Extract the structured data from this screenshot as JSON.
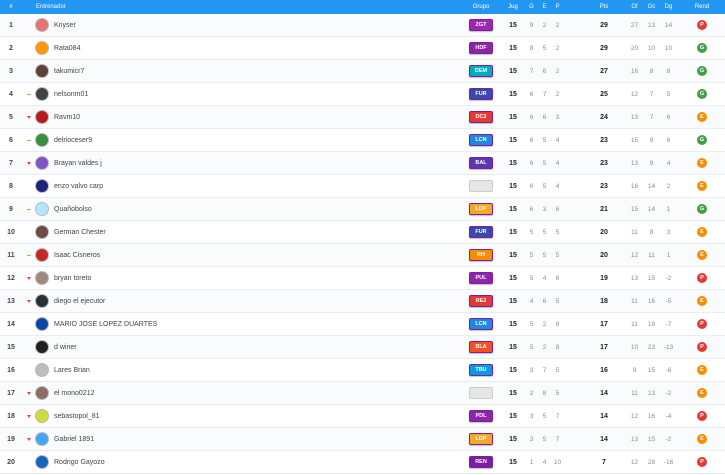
{
  "header": {
    "pos": "#",
    "team": "Entrenador",
    "group": "Grupo",
    "jug": "Jug",
    "g": "G",
    "e": "E",
    "p": "P",
    "pts": "Pts",
    "gf": "Gf",
    "gc": "Gc",
    "dg": "Dg",
    "rend": "Rend"
  },
  "colors": {
    "header_bg": "#2196f3",
    "rend_P": "#e53935",
    "rend_E": "#fb8c00",
    "rend_G": "#43a047"
  },
  "rows": [
    {
      "pos": "1",
      "trend": "none",
      "name": "Knyser",
      "group": "ZGT",
      "group_color": "#9c27b0",
      "jug": "15",
      "g": "9",
      "e": "2",
      "p": "2",
      "pts": "29",
      "gf": "27",
      "gc": "13",
      "dg": "14",
      "rend": "P",
      "avatar": "#e57373"
    },
    {
      "pos": "2",
      "trend": "none",
      "name": "Rata084",
      "group": "HDF",
      "group_color": "#8e24aa",
      "jug": "15",
      "g": "8",
      "e": "5",
      "p": "2",
      "pts": "29",
      "gf": "20",
      "gc": "10",
      "dg": "10",
      "rend": "G",
      "avatar": "#ff9800"
    },
    {
      "pos": "3",
      "trend": "none",
      "name": "takumicr7",
      "group": "DEM",
      "group_color": "#00acc1",
      "jug": "15",
      "g": "7",
      "e": "6",
      "p": "2",
      "pts": "27",
      "gf": "16",
      "gc": "8",
      "dg": "8",
      "rend": "G",
      "avatar": "#5d4037"
    },
    {
      "pos": "4",
      "trend": "flat",
      "name": "nelsonm01",
      "group": "FUR",
      "group_color": "#3949ab",
      "jug": "15",
      "g": "6",
      "e": "7",
      "p": "2",
      "pts": "25",
      "gf": "12",
      "gc": "7",
      "dg": "5",
      "rend": "G",
      "avatar": "#424242"
    },
    {
      "pos": "5",
      "trend": "down",
      "name": "Ravm10",
      "group": "DC2",
      "group_color": "#e53935",
      "jug": "15",
      "g": "6",
      "e": "6",
      "p": "3",
      "pts": "24",
      "gf": "13",
      "gc": "7",
      "dg": "6",
      "rend": "E",
      "avatar": "#b71c1c"
    },
    {
      "pos": "6",
      "trend": "flat",
      "name": "delrioceser9",
      "group": "LCN",
      "group_color": "#1e88e5",
      "jug": "15",
      "g": "6",
      "e": "5",
      "p": "4",
      "pts": "23",
      "gf": "15",
      "gc": "9",
      "dg": "6",
      "rend": "G",
      "avatar": "#388e3c"
    },
    {
      "pos": "7",
      "trend": "down",
      "name": "Brayan valdes j",
      "group": "BAL",
      "group_color": "#5e35b1",
      "jug": "15",
      "g": "6",
      "e": "5",
      "p": "4",
      "pts": "23",
      "gf": "13",
      "gc": "9",
      "dg": "4",
      "rend": "E",
      "avatar": "#7e57c2"
    },
    {
      "pos": "8",
      "trend": "none",
      "name": "enzo valvo carp",
      "group": "",
      "group_color": "",
      "jug": "15",
      "g": "6",
      "e": "5",
      "p": "4",
      "pts": "23",
      "gf": "16",
      "gc": "14",
      "dg": "2",
      "rend": "E",
      "avatar": "#1a237e"
    },
    {
      "pos": "9",
      "trend": "flat",
      "name": "Quañobolso",
      "group": "LDP",
      "group_color": "#f9a825",
      "jug": "15",
      "g": "6",
      "e": "3",
      "p": "6",
      "pts": "21",
      "gf": "15",
      "gc": "14",
      "dg": "1",
      "rend": "G",
      "avatar": "#b3e5fc"
    },
    {
      "pos": "10",
      "trend": "none",
      "name": "German Chester",
      "group": "FUR",
      "group_color": "#3949ab",
      "jug": "15",
      "g": "5",
      "e": "5",
      "p": "5",
      "pts": "20",
      "gf": "11",
      "gc": "8",
      "dg": "3",
      "rend": "E",
      "avatar": "#6d4c41"
    },
    {
      "pos": "11",
      "trend": "flat",
      "name": "Isaac Cisneros",
      "group": "RH",
      "group_color": "#fb8c00",
      "jug": "15",
      "g": "5",
      "e": "5",
      "p": "5",
      "pts": "20",
      "gf": "12",
      "gc": "11",
      "dg": "1",
      "rend": "E",
      "avatar": "#c62828"
    },
    {
      "pos": "12",
      "trend": "down",
      "name": "bryan toreto",
      "group": "PUL",
      "group_color": "#8e24aa",
      "jug": "15",
      "g": "5",
      "e": "4",
      "p": "6",
      "pts": "19",
      "gf": "13",
      "gc": "15",
      "dg": "-2",
      "rend": "P",
      "avatar": "#a1887f"
    },
    {
      "pos": "13",
      "trend": "down",
      "name": "diego el ejecutor",
      "group": "RE2",
      "group_color": "#e53935",
      "jug": "15",
      "g": "4",
      "e": "6",
      "p": "5",
      "pts": "18",
      "gf": "11",
      "gc": "16",
      "dg": "-5",
      "rend": "E",
      "avatar": "#263238"
    },
    {
      "pos": "14",
      "trend": "none",
      "name": "MARIO JOSE LOPEZ DUARTES",
      "group": "LCN",
      "group_color": "#1e88e5",
      "jug": "15",
      "g": "5",
      "e": "2",
      "p": "8",
      "pts": "17",
      "gf": "11",
      "gc": "18",
      "dg": "-7",
      "rend": "P",
      "avatar": "#0d47a1"
    },
    {
      "pos": "15",
      "trend": "none",
      "name": "d winer",
      "group": "BLA",
      "group_color": "#f4511e",
      "jug": "15",
      "g": "5",
      "e": "2",
      "p": "8",
      "pts": "17",
      "gf": "10",
      "gc": "23",
      "dg": "-13",
      "rend": "P",
      "avatar": "#212121"
    },
    {
      "pos": "16",
      "trend": "none",
      "name": "Lares Brian",
      "group": "TBU",
      "group_color": "#039be5",
      "jug": "15",
      "g": "3",
      "e": "7",
      "p": "5",
      "pts": "16",
      "gf": "9",
      "gc": "15",
      "dg": "-6",
      "rend": "E",
      "avatar": "#bdbdbd"
    },
    {
      "pos": "17",
      "trend": "down",
      "name": "el mono0212",
      "group": "",
      "group_color": "",
      "jug": "15",
      "g": "2",
      "e": "8",
      "p": "5",
      "pts": "14",
      "gf": "11",
      "gc": "13",
      "dg": "-2",
      "rend": "E",
      "avatar": "#8d6e63"
    },
    {
      "pos": "18",
      "trend": "down",
      "name": "sebastopol_81",
      "group": "PDL",
      "group_color": "#8e24aa",
      "jug": "15",
      "g": "3",
      "e": "5",
      "p": "7",
      "pts": "14",
      "gf": "12",
      "gc": "16",
      "dg": "-4",
      "rend": "P",
      "avatar": "#cddc39"
    },
    {
      "pos": "19",
      "trend": "down",
      "name": "Gabriel 1891",
      "group": "LDP",
      "group_color": "#f9a825",
      "jug": "15",
      "g": "3",
      "e": "5",
      "p": "7",
      "pts": "14",
      "gf": "13",
      "gc": "15",
      "dg": "-2",
      "rend": "E",
      "avatar": "#42a5f5"
    },
    {
      "pos": "20",
      "trend": "none",
      "name": "Rodrigo Gayozo",
      "group": "REN",
      "group_color": "#7b1fa2",
      "jug": "15",
      "g": "1",
      "e": "4",
      "p": "10",
      "pts": "7",
      "gf": "12",
      "gc": "28",
      "dg": "-16",
      "rend": "P",
      "avatar": "#1565c0"
    }
  ]
}
